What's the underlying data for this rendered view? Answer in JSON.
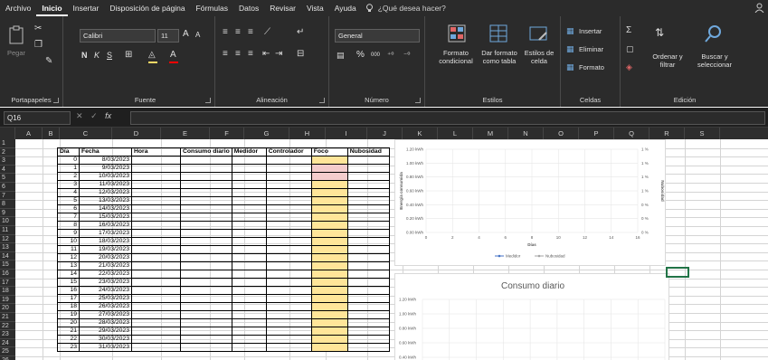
{
  "menu": {
    "tabs": [
      "Archivo",
      "Inicio",
      "Insertar",
      "Disposición de página",
      "Fórmulas",
      "Datos",
      "Revisar",
      "Vista",
      "Ayuda"
    ],
    "tell_me": "¿Qué desea hacer?"
  },
  "ribbon": {
    "clipboard": {
      "paste": "Pegar",
      "label": "Portapapeles"
    },
    "font": {
      "name": "Calibri",
      "size": "11",
      "grow": "A",
      "shrink": "A",
      "bold": "N",
      "italic": "K",
      "underline": "S",
      "label": "Fuente"
    },
    "alignment": {
      "label": "Alineación"
    },
    "number": {
      "format": "General",
      "percent": "%",
      "thousands": "000",
      "label": "Número"
    },
    "styles": {
      "conditional": "Formato condicional",
      "as_table": "Dar formato como tabla",
      "cell_styles": "Estilos de celda",
      "label": "Estilos"
    },
    "cells": {
      "insert": "Insertar",
      "delete": "Eliminar",
      "format": "Formato",
      "label": "Celdas"
    },
    "editing": {
      "sort": "Ordenar y filtrar",
      "find": "Buscar y seleccionar",
      "label": "Edición"
    }
  },
  "formula_bar": {
    "name_box": "Q16",
    "fx": "fx",
    "value": ""
  },
  "columns": [
    "A",
    "B",
    "C",
    "D",
    "E",
    "F",
    "G",
    "H",
    "I",
    "J",
    "K",
    "L",
    "M",
    "N",
    "O",
    "P",
    "Q",
    "R",
    "S"
  ],
  "rows": [
    "1",
    "2",
    "3",
    "4",
    "5",
    "6",
    "7",
    "8",
    "9",
    "10",
    "11",
    "12",
    "13",
    "14",
    "15",
    "16",
    "17",
    "18",
    "19",
    "20",
    "21",
    "22",
    "23",
    "24",
    "25",
    "26"
  ],
  "table": {
    "headers": [
      "Día",
      "Fecha",
      "Hora",
      "Consumo diario",
      "Medidor",
      "Controlador",
      "Foco",
      "Nubosidad"
    ],
    "rows": [
      [
        "0",
        "8/03/2023"
      ],
      [
        "1",
        "9/03/2023"
      ],
      [
        "2",
        "10/03/2023"
      ],
      [
        "3",
        "11/03/2023"
      ],
      [
        "4",
        "12/03/2023"
      ],
      [
        "5",
        "13/03/2023"
      ],
      [
        "6",
        "14/03/2023"
      ],
      [
        "7",
        "15/03/2023"
      ],
      [
        "8",
        "16/03/2023"
      ],
      [
        "9",
        "17/03/2023"
      ],
      [
        "10",
        "18/03/2023"
      ],
      [
        "11",
        "19/03/2023"
      ],
      [
        "12",
        "20/03/2023"
      ],
      [
        "13",
        "21/03/2023"
      ],
      [
        "14",
        "22/03/2023"
      ],
      [
        "15",
        "23/03/2023"
      ],
      [
        "16",
        "24/03/2023"
      ],
      [
        "17",
        "25/03/2023"
      ],
      [
        "18",
        "26/03/2023"
      ],
      [
        "19",
        "27/03/2023"
      ],
      [
        "20",
        "28/03/2023"
      ],
      [
        "21",
        "29/03/2023"
      ],
      [
        "22",
        "30/03/2023"
      ],
      [
        "23",
        "31/03/2023"
      ]
    ]
  },
  "colors": {
    "foco": "#ffe599",
    "foco_alert": "#f4cccc",
    "selection": "#217346"
  },
  "chart_data": [
    {
      "type": "line",
      "title": "",
      "xlabel": "Días",
      "ylabel": "Energía consumida",
      "y2label": "Nubosidad",
      "x_ticks": [
        "0",
        "2",
        "4",
        "6",
        "8",
        "10",
        "12",
        "14",
        "16"
      ],
      "y_ticks": [
        "0.00 kWh",
        "0.20 kWh",
        "0.40 kWh",
        "0.60 kWh",
        "0.80 kWh",
        "1.00 kWh",
        "1.20 kWh"
      ],
      "y2_ticks": [
        "0 %",
        "0 %",
        "0 %",
        "1 %",
        "1 %",
        "1 %",
        "1 %"
      ],
      "xlim": [
        0,
        16
      ],
      "ylim": [
        0,
        1.2
      ],
      "series": [
        {
          "name": "Medidor",
          "values": []
        },
        {
          "name": "Nubosidad",
          "values": []
        }
      ],
      "legend": "bottom"
    },
    {
      "type": "bar",
      "title": "Consumo diario",
      "y_ticks": [
        "0.20 kWh",
        "0.40 kWh",
        "0.60 kWh",
        "0.80 kWh",
        "1.00 kWh",
        "1.20 kWh"
      ],
      "ylim": [
        0,
        1.2
      ],
      "series": []
    }
  ]
}
